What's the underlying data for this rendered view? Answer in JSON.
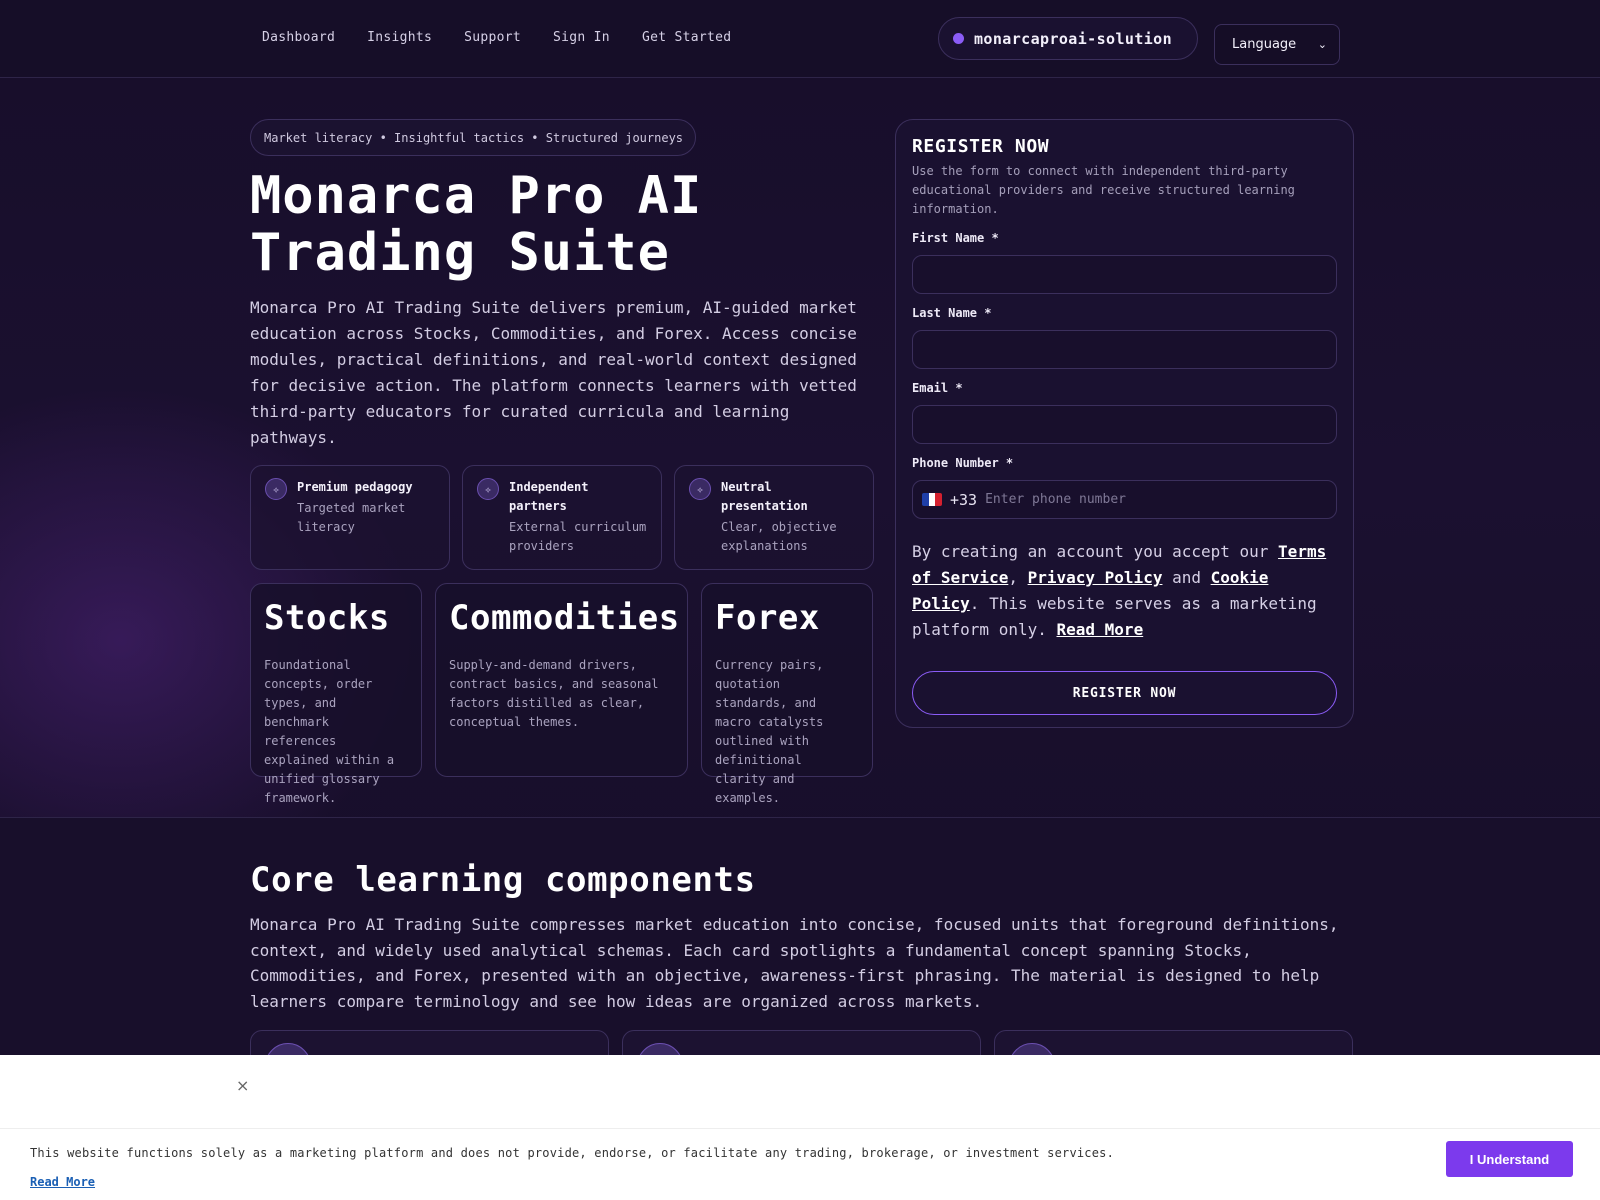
{
  "nav": {
    "items": [
      "Dashboard",
      "Insights",
      "Support",
      "Sign In",
      "Get Started"
    ]
  },
  "brand": {
    "name": "monarcaproai-solution"
  },
  "language": {
    "label": "Language"
  },
  "hero": {
    "pill": "Market literacy • Insightful tactics • Structured journeys",
    "title_line1": "Monarca Pro AI",
    "title_line2": "Trading Suite",
    "description": "Monarca Pro AI Trading Suite delivers premium, AI-guided market education across Stocks, Commodities, and Forex. Access concise modules, practical definitions, and real-world context designed for decisive action. The platform connects learners with vetted third-party educators for curated curricula and learning pathways.",
    "features": [
      {
        "title": "Premium pedagogy",
        "subtitle": "Targeted market literacy"
      },
      {
        "title": "Independent partners",
        "subtitle": "External curriculum providers"
      },
      {
        "title": "Neutral presentation",
        "subtitle": "Clear, objective explanations"
      }
    ],
    "markets": [
      {
        "title": "Stocks",
        "text": "Foundational concepts, order types, and benchmark references explained within a unified glossary framework."
      },
      {
        "title": "Commodities",
        "text": "Supply-and-demand drivers, contract basics, and seasonal factors distilled as clear, conceptual themes."
      },
      {
        "title": "Forex",
        "text": "Currency pairs, quotation standards, and macro catalysts outlined with definitional clarity and examples."
      }
    ]
  },
  "register": {
    "title": "REGISTER NOW",
    "subtitle": "Use the form to connect with independent third-party educational providers and receive structured learning information.",
    "first_name_label": "First Name *",
    "last_name_label": "Last Name *",
    "email_label": "Email *",
    "phone_label": "Phone Number *",
    "phone_code": "+33",
    "phone_placeholder": "Enter phone number",
    "terms_prefix": "By creating an account you accept our ",
    "terms_link": "Terms of Service",
    "terms_comma": ", ",
    "privacy_link": "Privacy Policy",
    "terms_and": " and ",
    "cookie_link": "Cookie Policy",
    "terms_suffix": ". This website serves as a marketing platform only. ",
    "read_more": "Read More",
    "button": "REGISTER NOW"
  },
  "core": {
    "title": "Core learning components",
    "description": "Monarca Pro AI Trading Suite compresses market education into concise, focused units that foreground definitions, context, and widely used analytical schemas. Each card spotlights a fundamental concept spanning Stocks, Commodities, and Forex, presented with an objective, awareness-first phrasing. The material is designed to help learners compare terminology and see how ideas are organized across markets."
  },
  "banner": {
    "close": "×",
    "message": "This website functions solely as a marketing platform and does not provide, endorse, or facilitate any trading, brokerage, or investment services.",
    "read_more": "Read More",
    "button": "I Understand"
  },
  "colors": {
    "accent": "#8b5cf6",
    "button_accent": "#7c3aed",
    "background": "#170e2a"
  }
}
